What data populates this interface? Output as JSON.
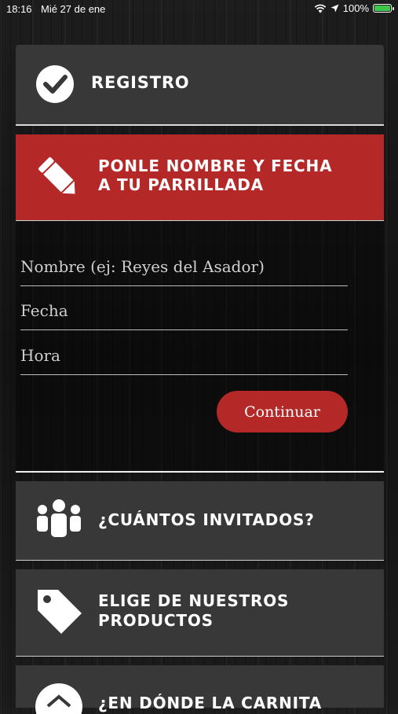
{
  "status_bar": {
    "time": "18:16",
    "date": "Mié 27 de ene",
    "battery": "100%"
  },
  "steps": {
    "registro": "REGISTRO",
    "parrillada_line1": "PONLE NOMBRE Y FECHA",
    "parrillada_line2": "A TU PARRILLADA",
    "invitados": "¿CUÁNTOS INVITADOS?",
    "productos_line1": "ELIGE DE NUESTROS",
    "productos_line2": "PRODUCTOS",
    "carnita_partial": "¿EN DÓNDE LA CARNITA"
  },
  "form": {
    "name_placeholder": "Nombre (ej: Reyes del Asador)",
    "date_placeholder": "Fecha",
    "time_placeholder": "Hora",
    "continue_label": "Continuar"
  },
  "colors": {
    "accent_red": "#b52828",
    "panel_gray": "#383838"
  },
  "icons": {
    "registro": "check-circle-icon",
    "parrillada": "pencil-icon",
    "invitados": "people-group-icon",
    "productos": "price-tag-icon",
    "carnita": "house-icon"
  }
}
